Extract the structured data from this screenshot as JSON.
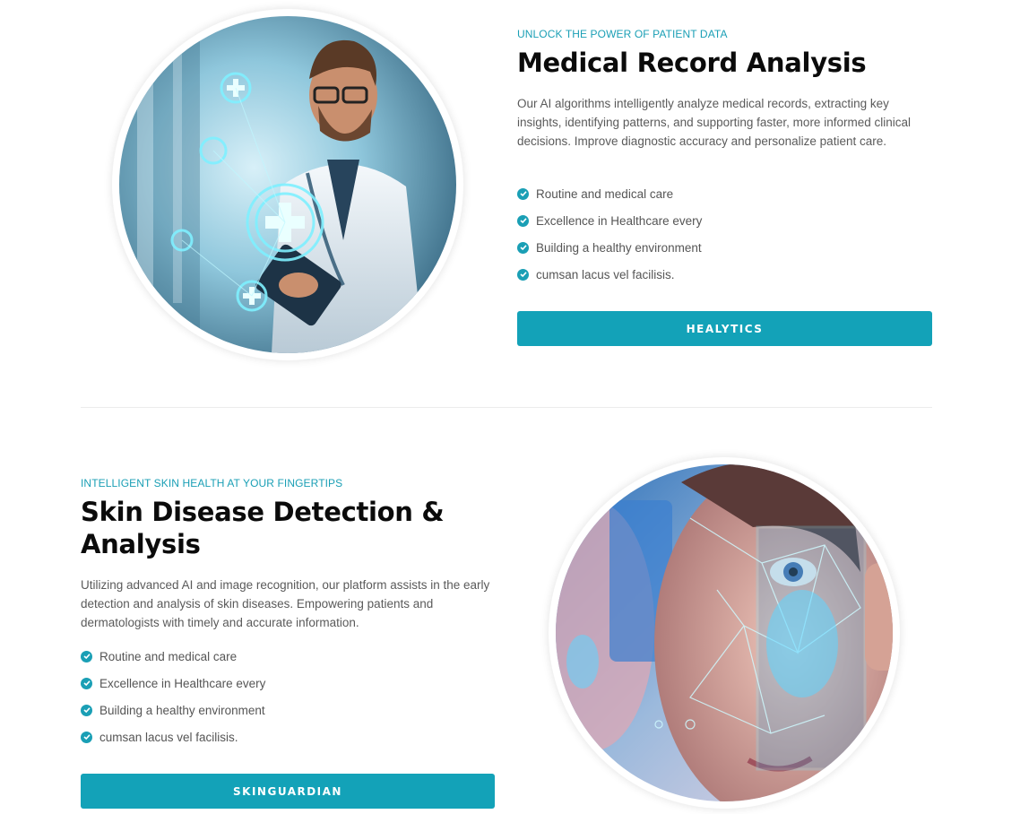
{
  "section1": {
    "eyebrow": "UNLOCK THE POWER OF PATIENT DATA",
    "title": "Medical Record Analysis",
    "description": "Our AI algorithms intelligently analyze medical records, extracting key insights, identifying patterns, and supporting faster, more informed clinical decisions. Improve diagnostic accuracy and personalize patient care.",
    "features": [
      "Routine and medical care",
      "Excellence in Healthcare every",
      "Building a healthy environment",
      "cumsan lacus vel facilisis."
    ],
    "button_label": "HEALYTICS",
    "image": "doctor-with-tablet-holographic-medical-icons"
  },
  "section2": {
    "eyebrow": "INTELLIGENT SKIN HEALTH AT YOUR FINGERTIPS",
    "title_line1": "Skin Disease Detection &",
    "title_line2": "Analysis",
    "description": "Utilizing advanced AI and image recognition, our platform assists in the early detection and analysis of skin diseases. Empowering patients and dermatologists with timely and accurate information.",
    "features": [
      "Routine and medical care",
      "Excellence in Healthcare every",
      "Building a healthy environment",
      "cumsan lacus vel facilisis."
    ],
    "button_label": "SKINGUARDIAN",
    "image": "woman-face-scan-holographic-overlay"
  },
  "colors": {
    "accent": "#13a2b8",
    "heading": "#0b0b0b",
    "body_text": "#5a5a5a"
  },
  "icons": {
    "feature_bullet": "check-circle-icon"
  }
}
